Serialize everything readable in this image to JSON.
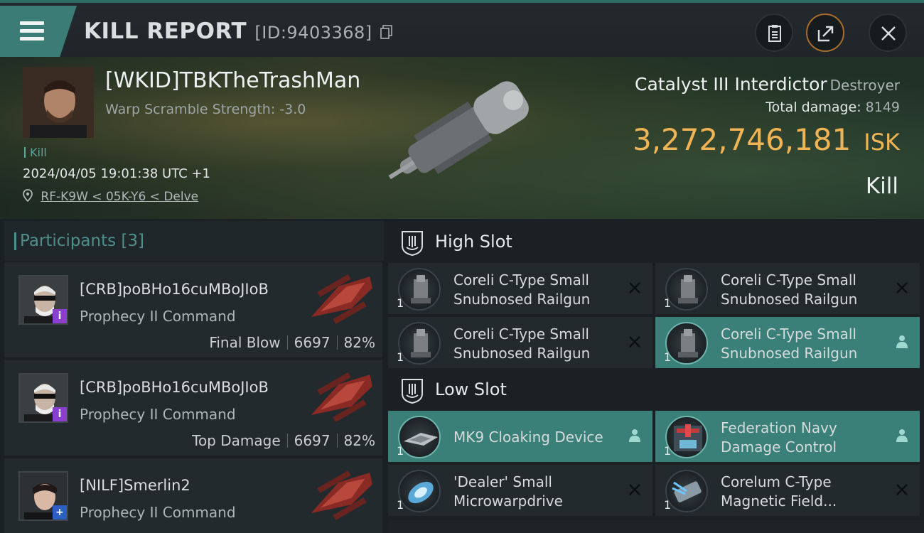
{
  "header": {
    "title": "KILL REPORT",
    "id_label": "[ID:9403368]"
  },
  "victim": {
    "name": "[WKID]TBKTheTrashMan",
    "stat": "Warp Scramble Strength: -3.0",
    "tag": "Kill",
    "datetime": "2024/04/05 19:01:38 UTC +1",
    "location": "RF-K9W < 05K-Y6 < Delve",
    "ship": "Catalyst III Interdictor",
    "ship_class": "Destroyer",
    "total_damage_label": "Total damage:",
    "total_damage": "8149",
    "isk_amount": "3,272,746,181",
    "isk_unit": "ISK",
    "result": "Kill"
  },
  "participants": {
    "label": "Participants [3]",
    "items": [
      {
        "name": "[CRB]poBHo16cuMBoJIoB",
        "ship": "Prophecy II Command",
        "role": "Final Blow",
        "damage": "6697",
        "percent": "82%",
        "badge_color": "#8a3fd1",
        "badge": "i"
      },
      {
        "name": "[CRB]poBHo16cuMBoJIoB",
        "ship": "Prophecy II Command",
        "role": "Top Damage",
        "damage": "6697",
        "percent": "82%",
        "badge_color": "#8a3fd1",
        "badge": "i"
      },
      {
        "name": "[NILF]Smerlin2",
        "ship": "Prophecy II Command",
        "badge_color": "#2b5fc4",
        "badge": "+"
      }
    ]
  },
  "slots": {
    "high": {
      "label": "High Slot",
      "modules": [
        {
          "line1": "Coreli C-Type Small",
          "line2": "Snubnosed Railgun",
          "qty": "1",
          "state": "destroyed"
        },
        {
          "line1": "Coreli C-Type Small",
          "line2": "Snubnosed Railgun",
          "qty": "1",
          "state": "destroyed"
        },
        {
          "line1": "Coreli C-Type Small",
          "line2": "Snubnosed Railgun",
          "qty": "1",
          "state": "destroyed"
        },
        {
          "line1": "Coreli C-Type Small",
          "line2": "Snubnosed Railgun",
          "qty": "1",
          "state": "dropped"
        }
      ]
    },
    "low": {
      "label": "Low Slot",
      "modules": [
        {
          "line1": "MK9 Cloaking Device",
          "qty": "1",
          "state": "dropped"
        },
        {
          "line1": "Federation Navy",
          "line2": "Damage Control",
          "qty": "1",
          "state": "dropped"
        },
        {
          "line1": "'Dealer' Small",
          "line2": "Microwarpdrive",
          "qty": "1",
          "state": "destroyed"
        },
        {
          "line1": "Corelum C-Type",
          "line2": "Magnetic Field...",
          "qty": "1",
          "state": "destroyed"
        }
      ]
    }
  },
  "colors": {
    "accent": "#3a7f78",
    "isk": "#f0b454",
    "bg": "#1a2024"
  }
}
